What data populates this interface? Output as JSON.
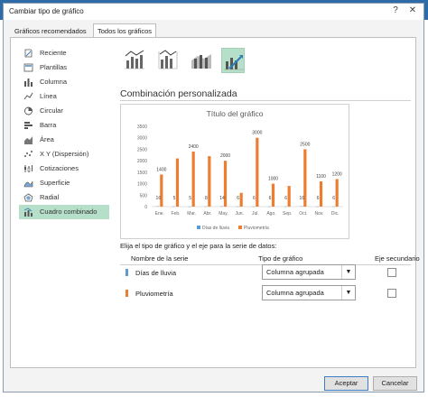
{
  "dialog": {
    "title": "Cambiar tipo de gráfico",
    "help_glyph": "?",
    "close_glyph": "✕"
  },
  "tabs": [
    {
      "label": "Gráficos recomendados",
      "active": false
    },
    {
      "label": "Todos los gráficos",
      "active": true
    }
  ],
  "chart_types": [
    {
      "label": "Reciente",
      "icon": "recent-icon"
    },
    {
      "label": "Plantillas",
      "icon": "templates-icon"
    },
    {
      "label": "Columna",
      "icon": "column-chart-icon"
    },
    {
      "label": "Línea",
      "icon": "line-chart-icon"
    },
    {
      "label": "Circular",
      "icon": "pie-chart-icon"
    },
    {
      "label": "Barra",
      "icon": "bar-chart-icon"
    },
    {
      "label": "Área",
      "icon": "area-chart-icon"
    },
    {
      "label": "X Y (Dispersión)",
      "icon": "scatter-chart-icon"
    },
    {
      "label": "Cotizaciones",
      "icon": "stock-chart-icon"
    },
    {
      "label": "Superficie",
      "icon": "surface-chart-icon"
    },
    {
      "label": "Radial",
      "icon": "radar-chart-icon"
    },
    {
      "label": "Cuadro combinado",
      "icon": "combo-chart-icon",
      "selected": true
    }
  ],
  "subtypes": [
    {
      "icon": "clustered-column-line-icon",
      "selected": false
    },
    {
      "icon": "clustered-column-line-secondary-icon",
      "selected": false
    },
    {
      "icon": "stacked-area-column-icon",
      "selected": false
    },
    {
      "icon": "custom-combination-icon",
      "selected": true
    }
  ],
  "section": {
    "title": "Combinación personalizada",
    "prompt": "Elija el tipo de gráfico y el eje para la serie de datos:"
  },
  "series_table": {
    "headers": {
      "name": "Nombre de la serie",
      "type": "Tipo de gráfico",
      "secondary": "Eje secundario"
    },
    "rows": [
      {
        "name": "Días de lluvia",
        "type": "Columna agrupada",
        "color": "#5b9bd5",
        "secondary_axis": false
      },
      {
        "name": "Pluviometría",
        "type": "Columna agrupada",
        "color": "#ed7d31",
        "secondary_axis": false
      }
    ]
  },
  "buttons": {
    "ok": "Aceptar",
    "cancel": "Cancelar"
  },
  "colors": {
    "accent_selected": "#b6dfc9",
    "series_blue": "#5b9bd5",
    "series_orange": "#ed7d31",
    "button_focus": "#3c7fc4"
  },
  "chart_data": {
    "type": "bar",
    "title": "Título del gráfico",
    "categories": [
      "Ene.",
      "Feb.",
      "Mar.",
      "Abr.",
      "May.",
      "Jun.",
      "Jul.",
      "Ago.",
      "Sep.",
      "Oct.",
      "Nov.",
      "Dic."
    ],
    "series": [
      {
        "name": "Días de lluvia",
        "values": [
          16,
          5,
          5,
          8,
          14,
          6,
          6,
          6,
          6,
          16,
          6,
          6
        ],
        "color": "#5b9bd5"
      },
      {
        "name": "Pluviometría",
        "values": [
          1400,
          2100,
          2400,
          2200,
          2000,
          600,
          3000,
          1000,
          900,
          2500,
          1100,
          1200
        ],
        "color": "#ed7d31"
      }
    ],
    "data_labels": [
      {
        "series": 1,
        "point": 0,
        "text": "1400"
      },
      {
        "series": 1,
        "point": 2,
        "text": "2400"
      },
      {
        "series": 1,
        "point": 4,
        "text": "2000"
      },
      {
        "series": 1,
        "point": 6,
        "text": "3000"
      },
      {
        "series": 1,
        "point": 7,
        "text": "1000"
      },
      {
        "series": 1,
        "point": 9,
        "text": "2500"
      },
      {
        "series": 1,
        "point": 10,
        "text": "1100"
      },
      {
        "series": 1,
        "point": 11,
        "text": "1200"
      },
      {
        "series": 0,
        "point": 0,
        "text": "16"
      },
      {
        "series": 0,
        "point": 1,
        "text": "5"
      },
      {
        "series": 0,
        "point": 2,
        "text": "5"
      },
      {
        "series": 0,
        "point": 3,
        "text": "8"
      },
      {
        "series": 0,
        "point": 4,
        "text": "14"
      },
      {
        "series": 0,
        "point": 5,
        "text": "6"
      },
      {
        "series": 0,
        "point": 6,
        "text": "6"
      },
      {
        "series": 0,
        "point": 7,
        "text": "6"
      },
      {
        "series": 0,
        "point": 8,
        "text": "6"
      },
      {
        "series": 0,
        "point": 9,
        "text": "16"
      },
      {
        "series": 0,
        "point": 10,
        "text": "6"
      },
      {
        "series": 0,
        "point": 11,
        "text": "6"
      }
    ],
    "y_ticks": [
      "0",
      "500",
      "1000",
      "1500",
      "2000",
      "2500",
      "3000",
      "3500"
    ],
    "ylim": [
      0,
      3500
    ],
    "legend_position": "bottom",
    "grid": false
  }
}
